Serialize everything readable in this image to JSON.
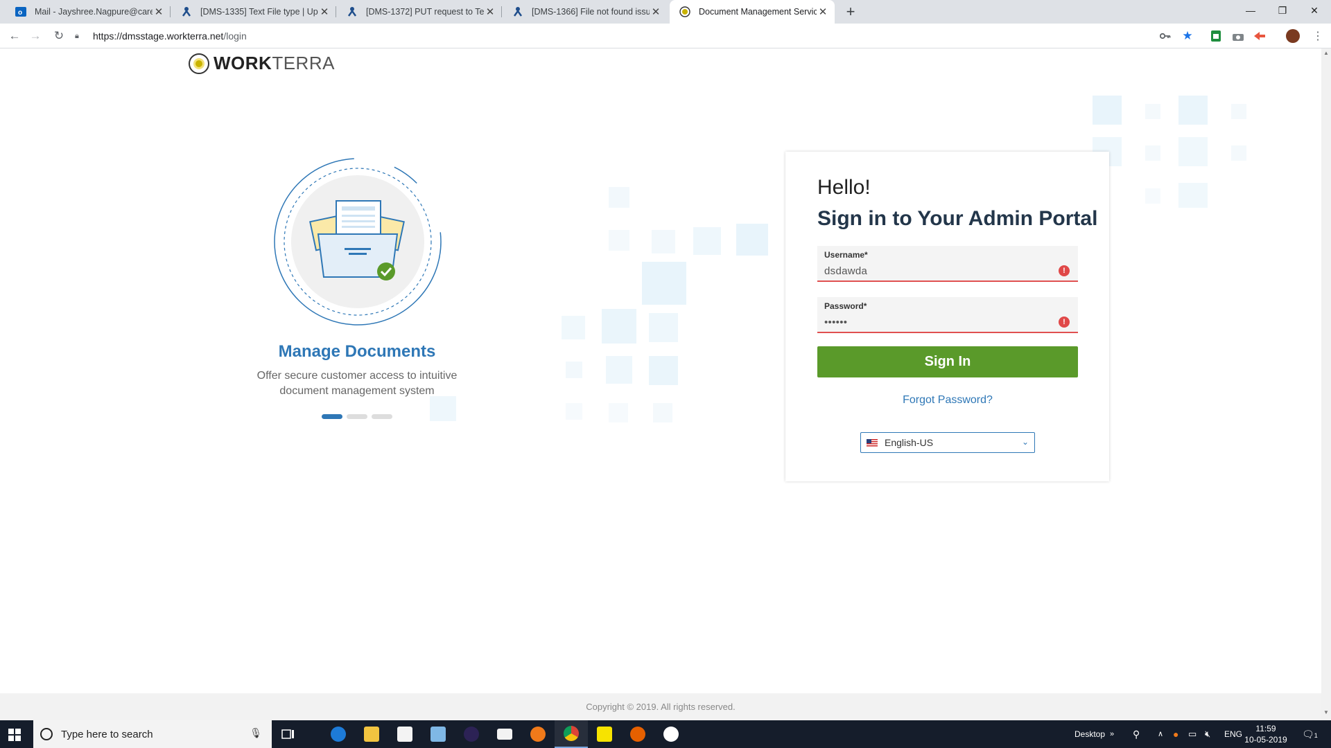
{
  "browser": {
    "tabs": [
      {
        "title": "Mail - Jayshree.Nagpure@careers",
        "icon": "outlook-icon",
        "active": false
      },
      {
        "title": "[DMS-1335] Text File type | Upda",
        "icon": "jira-icon",
        "active": false
      },
      {
        "title": "[DMS-1372] PUT request to Text",
        "icon": "jira-icon",
        "active": false
      },
      {
        "title": "[DMS-1366] File not found issue",
        "icon": "jira-icon",
        "active": false
      },
      {
        "title": "Document Management Service",
        "icon": "workterra-icon",
        "active": true
      }
    ],
    "url_host": "https://dmsstage.workterra.net",
    "url_path": "/login"
  },
  "page": {
    "logo": {
      "bold": "WORK",
      "light": "TERRA"
    },
    "carousel": {
      "title": "Manage Documents",
      "description": "Offer secure customer access to intuitive document management system",
      "slide_count": 3,
      "active_slide": 0
    },
    "login": {
      "greeting": "Hello!",
      "title": "Sign in to Your Admin Portal",
      "username_label": "Username*",
      "username_value": "dsdawda",
      "password_label": "Password*",
      "password_value": "••••••",
      "sign_in_label": "Sign In",
      "forgot_label": "Forgot Password?",
      "language": "English-US"
    },
    "footer": "Copyright © 2019. All rights reserved.",
    "colors": {
      "accent": "#2e77b6",
      "button": "#5a9a2a",
      "error": "#e04848",
      "heading": "#23364a"
    }
  },
  "taskbar": {
    "search_placeholder": "Type here to search",
    "desktop_label": "Desktop",
    "language": "ENG",
    "time": "11:59",
    "date": "10-05-2019",
    "notification_count": "1"
  }
}
